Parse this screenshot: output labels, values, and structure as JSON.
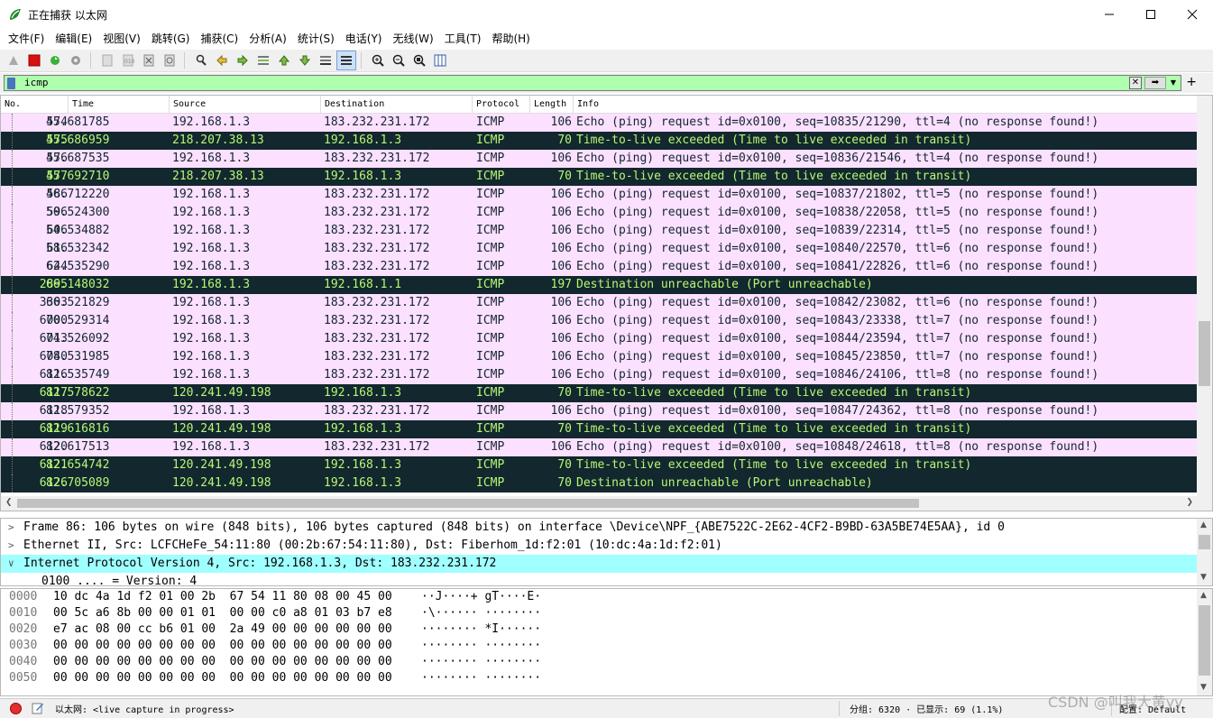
{
  "window": {
    "title": "正在捕获 以太网",
    "minimize_icon": "minimize-icon",
    "maximize_icon": "maximize-icon",
    "close_icon": "close-icon"
  },
  "menu": [
    "文件(F)",
    "编辑(E)",
    "视图(V)",
    "跳转(G)",
    "捕获(C)",
    "分析(A)",
    "统计(S)",
    "电话(Y)",
    "无线(W)",
    "工具(T)",
    "帮助(H)"
  ],
  "toolbar_icons": [
    "start-capture-icon",
    "stop-capture-icon",
    "restart-capture-icon",
    "capture-options-icon",
    "open-file-icon",
    "save-file-icon",
    "close-file-icon",
    "reload-file-icon",
    "find-packet-icon",
    "go-back-icon",
    "go-forward-icon",
    "go-to-packet-icon",
    "go-first-packet-icon",
    "go-last-packet-icon",
    "auto-scroll-icon",
    "colorize-icon",
    "zoom-in-icon",
    "zoom-out-icon",
    "zoom-normal-icon",
    "resize-columns-icon"
  ],
  "filter": {
    "value": "icmp"
  },
  "columns": {
    "no": "No.",
    "time": "Time",
    "source": "Source",
    "destination": "Destination",
    "protocol": "Protocol",
    "length": "Length",
    "info": "Info"
  },
  "packets": [
    {
      "no": "574",
      "time": "45.681785",
      "src": "192.168.1.3",
      "dst": "183.232.231.172",
      "proto": "ICMP",
      "len": "106",
      "info": "Echo (ping) request  id=0x0100, seq=10835/21290, ttl=4 (no response found!)",
      "kind": "echo"
    },
    {
      "no": "575",
      "time": "45.686959",
      "src": "218.207.38.13",
      "dst": "192.168.1.3",
      "proto": "ICMP",
      "len": "70",
      "info": "Time-to-live exceeded (Time to live exceeded in transit)",
      "kind": "ttl"
    },
    {
      "no": "576",
      "time": "45.687535",
      "src": "192.168.1.3",
      "dst": "183.232.231.172",
      "proto": "ICMP",
      "len": "106",
      "info": "Echo (ping) request  id=0x0100, seq=10836/21546, ttl=4 (no response found!)",
      "kind": "echo"
    },
    {
      "no": "577",
      "time": "45.692710",
      "src": "218.207.38.13",
      "dst": "192.168.1.3",
      "proto": "ICMP",
      "len": "70",
      "info": "Time-to-live exceeded (Time to live exceeded in transit)",
      "kind": "ttl"
    },
    {
      "no": "586",
      "time": "46.712220",
      "src": "192.168.1.3",
      "dst": "183.232.231.172",
      "proto": "ICMP",
      "len": "106",
      "info": "Echo (ping) request  id=0x0100, seq=10837/21802, ttl=5 (no response found!)",
      "kind": "echo"
    },
    {
      "no": "596",
      "time": "50.524300",
      "src": "192.168.1.3",
      "dst": "183.232.231.172",
      "proto": "ICMP",
      "len": "106",
      "info": "Echo (ping) request  id=0x0100, seq=10838/22058, ttl=5 (no response found!)",
      "kind": "echo"
    },
    {
      "no": "606",
      "time": "54.534882",
      "src": "192.168.1.3",
      "dst": "183.232.231.172",
      "proto": "ICMP",
      "len": "106",
      "info": "Echo (ping) request  id=0x0100, seq=10839/22314, ttl=5 (no response found!)",
      "kind": "echo"
    },
    {
      "no": "616",
      "time": "58.532342",
      "src": "192.168.1.3",
      "dst": "183.232.231.172",
      "proto": "ICMP",
      "len": "106",
      "info": "Echo (ping) request  id=0x0100, seq=10840/22570, ttl=6 (no response found!)",
      "kind": "echo"
    },
    {
      "no": "644",
      "time": "62.535290",
      "src": "192.168.1.3",
      "dst": "183.232.231.172",
      "proto": "ICMP",
      "len": "106",
      "info": "Echo (ping) request  id=0x0100, seq=10841/22826, ttl=6 (no response found!)",
      "kind": "echo"
    },
    {
      "no": "2895",
      "time": "66.148032",
      "src": "192.168.1.3",
      "dst": "192.168.1.1",
      "proto": "ICMP",
      "len": "197",
      "info": "Destination unreachable (Port unreachable)",
      "kind": "ttl"
    },
    {
      "no": "3303",
      "time": "66.521829",
      "src": "192.168.1.3",
      "dst": "183.232.231.172",
      "proto": "ICMP",
      "len": "106",
      "info": "Echo (ping) request  id=0x0100, seq=10842/23082, ttl=6 (no response found!)",
      "kind": "echo"
    },
    {
      "no": "6000",
      "time": "70.529314",
      "src": "192.168.1.3",
      "dst": "183.232.231.172",
      "proto": "ICMP",
      "len": "106",
      "info": "Echo (ping) request  id=0x0100, seq=10843/23338, ttl=7 (no response found!)",
      "kind": "echo"
    },
    {
      "no": "6013",
      "time": "74.526092",
      "src": "192.168.1.3",
      "dst": "183.232.231.172",
      "proto": "ICMP",
      "len": "106",
      "info": "Echo (ping) request  id=0x0100, seq=10844/23594, ttl=7 (no response found!)",
      "kind": "echo"
    },
    {
      "no": "6040",
      "time": "78.531985",
      "src": "192.168.1.3",
      "dst": "183.232.231.172",
      "proto": "ICMP",
      "len": "106",
      "info": "Echo (ping) request  id=0x0100, seq=10845/23850, ttl=7 (no response found!)",
      "kind": "echo"
    },
    {
      "no": "6116",
      "time": "82.535749",
      "src": "192.168.1.3",
      "dst": "183.232.231.172",
      "proto": "ICMP",
      "len": "106",
      "info": "Echo (ping) request  id=0x0100, seq=10846/24106, ttl=8 (no response found!)",
      "kind": "echo"
    },
    {
      "no": "6117",
      "time": "82.578622",
      "src": "120.241.49.198",
      "dst": "192.168.1.3",
      "proto": "ICMP",
      "len": "70",
      "info": "Time-to-live exceeded (Time to live exceeded in transit)",
      "kind": "ttl"
    },
    {
      "no": "6118",
      "time": "82.579352",
      "src": "192.168.1.3",
      "dst": "183.232.231.172",
      "proto": "ICMP",
      "len": "106",
      "info": "Echo (ping) request  id=0x0100, seq=10847/24362, ttl=8 (no response found!)",
      "kind": "echo"
    },
    {
      "no": "6119",
      "time": "82.616816",
      "src": "120.241.49.198",
      "dst": "192.168.1.3",
      "proto": "ICMP",
      "len": "70",
      "info": "Time-to-live exceeded (Time to live exceeded in transit)",
      "kind": "ttl"
    },
    {
      "no": "6120",
      "time": "82.617513",
      "src": "192.168.1.3",
      "dst": "183.232.231.172",
      "proto": "ICMP",
      "len": "106",
      "info": "Echo (ping) request  id=0x0100, seq=10848/24618, ttl=8 (no response found!)",
      "kind": "echo"
    },
    {
      "no": "6121",
      "time": "82.654742",
      "src": "120.241.49.198",
      "dst": "192.168.1.3",
      "proto": "ICMP",
      "len": "70",
      "info": "Time-to-live exceeded (Time to live exceeded in transit)",
      "kind": "ttl"
    },
    {
      "no": "6126",
      "time": "82.705089",
      "src": "120.241.49.198",
      "dst": "192.168.1.3",
      "proto": "ICMP",
      "len": "70",
      "info": "Destination unreachable (Port unreachable)",
      "kind": "ttl"
    }
  ],
  "details": [
    {
      "text": "Frame 86: 106 bytes on wire (848 bits), 106 bytes captured (848 bits) on interface \\Device\\NPF_{ABE7522C-2E62-4CF2-B9BD-63A5BE74E5AA}, id 0",
      "expanded": false,
      "selected": false
    },
    {
      "text": "Ethernet II, Src: LCFCHeFe_54:11:80 (00:2b:67:54:11:80), Dst: Fiberhom_1d:f2:01 (10:dc:4a:1d:f2:01)",
      "expanded": false,
      "selected": false
    },
    {
      "text": "Internet Protocol Version 4, Src: 192.168.1.3, Dst: 183.232.231.172",
      "expanded": true,
      "selected": true
    },
    {
      "text": "0100 .... = Version: 4",
      "expanded": false,
      "selected": false
    }
  ],
  "bytes": [
    {
      "off": "0000",
      "hex": "10 dc 4a 1d f2 01 00 2b  67 54 11 80 08 00 45 00",
      "ascii": "··J····+ gT····E·"
    },
    {
      "off": "0010",
      "hex": "00 5c a6 8b 00 00 01 01  00 00 c0 a8 01 03 b7 e8",
      "ascii": "·\\······ ········"
    },
    {
      "off": "0020",
      "hex": "e7 ac 08 00 cc b6 01 00  2a 49 00 00 00 00 00 00",
      "ascii": "········ *I······"
    },
    {
      "off": "0030",
      "hex": "00 00 00 00 00 00 00 00  00 00 00 00 00 00 00 00",
      "ascii": "········ ········"
    },
    {
      "off": "0040",
      "hex": "00 00 00 00 00 00 00 00  00 00 00 00 00 00 00 00",
      "ascii": "········ ········"
    },
    {
      "off": "0050",
      "hex": "00 00 00 00 00 00 00 00  00 00 00 00 00 00 00 00",
      "ascii": "········ ········"
    }
  ],
  "status": {
    "text": "以太网: <live capture in progress>",
    "stats": "分组: 6320 · 已显示: 69 (1.1%)",
    "profile": "配置: Default"
  },
  "watermark": "CSDN @叫我大黄yy"
}
